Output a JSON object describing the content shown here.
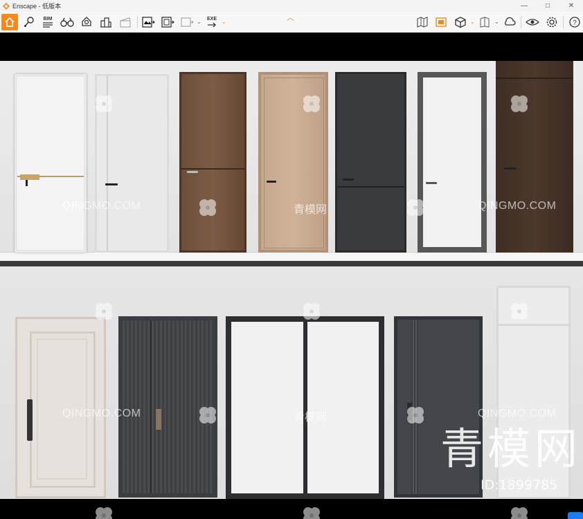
{
  "window": {
    "title": "Enscape - 低版本",
    "controls": [
      "—",
      "□",
      "✕"
    ]
  },
  "toolbar": {
    "bim_label": "BIM",
    "exe_label": "EXE",
    "accent_color": "#f28a1e",
    "left_icons": [
      "home-icon",
      "location-pin-icon",
      "bim-icon",
      "binoculars-icon",
      "bell-icon",
      "buildings-icon",
      "film-clapper-icon"
    ],
    "export_icons": [
      "export-image-icon",
      "export-batch-icon",
      "export-panorama-icon",
      "export-exe-icon"
    ],
    "right_icons": [
      "map-icon",
      "minimap-icon",
      "cube-icon",
      "book-icon",
      "cloud-icon",
      "eye-icon",
      "settings-icon",
      "help-icon"
    ]
  },
  "viewport": {
    "watermark_text": "QINGMO.COM",
    "watermark_cn": "青模网",
    "brand_text": "青模网",
    "id_text": "ID:1899785"
  }
}
